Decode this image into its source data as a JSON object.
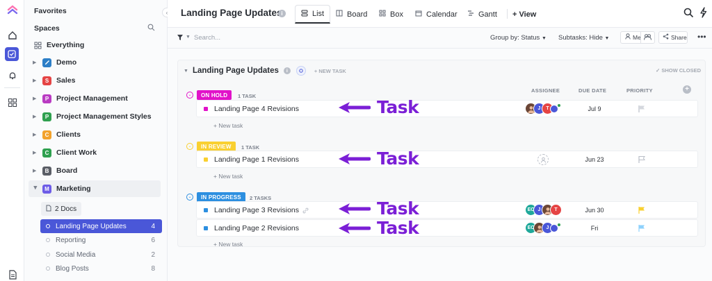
{
  "sidebar": {
    "favorites": "Favorites",
    "spaces": "Spaces",
    "everything": "Everything",
    "spaces_list": [
      {
        "label": "Demo",
        "letter": "",
        "color": "#2d7fc7"
      },
      {
        "label": "Sales",
        "letter": "S",
        "color": "#e54444"
      },
      {
        "label": "Project Management",
        "letter": "P",
        "color": "#b93bc2"
      },
      {
        "label": "Project Management Styles",
        "letter": "P",
        "color": "#2ea04f"
      },
      {
        "label": "Clients",
        "letter": "C",
        "color": "#f2a22c"
      },
      {
        "label": "Client Work",
        "letter": "C",
        "color": "#2ea04f"
      },
      {
        "label": "Board",
        "letter": "B",
        "color": "#5a5e66"
      },
      {
        "label": "Marketing",
        "letter": "M",
        "color": "#6d5ce7"
      }
    ],
    "docs": "2 Docs",
    "lists": [
      {
        "label": "Landing Page Updates",
        "count": "4"
      },
      {
        "label": "Reporting",
        "count": "6"
      },
      {
        "label": "Social Media",
        "count": "2"
      },
      {
        "label": "Blog Posts",
        "count": "8"
      }
    ]
  },
  "header": {
    "title": "Landing Page Updates",
    "tabs": [
      "List",
      "Board",
      "Box",
      "Calendar",
      "Gantt"
    ],
    "add_view": "+ View"
  },
  "toolbar": {
    "search_placeholder": "Search...",
    "group_by": "Group by: Status",
    "subtasks": "Subtasks: Hide",
    "me": "Me",
    "share": "Share"
  },
  "list": {
    "title": "Landing Page Updates",
    "new_task": "+ NEW TASK",
    "show_closed": "✓ SHOW CLOSED",
    "columns": {
      "assignee": "ASSIGNEE",
      "due": "DUE DATE",
      "priority": "PRIORITY"
    },
    "add_task_link": "+ New task",
    "groups": [
      {
        "status": "ON HOLD",
        "color": "#e112c9",
        "count": "1 TASK",
        "tasks": [
          {
            "name": "Landing Page 4 Revisions",
            "due": "Jul 9"
          }
        ]
      },
      {
        "status": "IN REVIEW",
        "color": "#f9d030",
        "count": "1 TASK",
        "tasks": [
          {
            "name": "Landing Page 1 Revisions",
            "due": "Jun 23"
          }
        ]
      },
      {
        "status": "IN PROGRESS",
        "color": "#2d8fe0",
        "count": "2 TASKS",
        "tasks": [
          {
            "name": "Landing Page 3 Revisions",
            "due": "Jun 30"
          },
          {
            "name": "Landing Page 2 Revisions",
            "due": "Fri"
          }
        ]
      }
    ]
  },
  "avatars": {
    "ec": "EC",
    "j": "J",
    "t": "T"
  },
  "annotation": "Task",
  "colors": {
    "accent": "#4a57d8",
    "annotation": "#7b1fd6",
    "flag_yellow": "#f9d030",
    "flag_blue": "#8ed1fc"
  }
}
